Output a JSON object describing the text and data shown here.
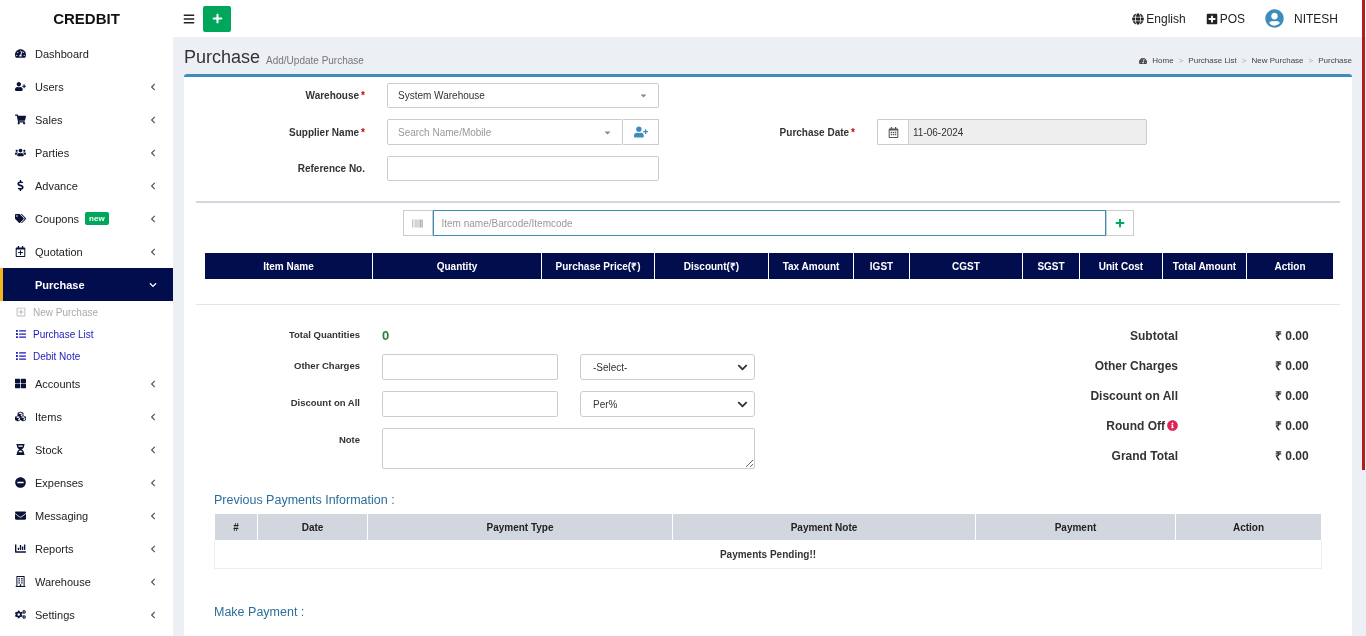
{
  "brand": "CREDBIT",
  "topbar": {
    "language": "English",
    "pos": "POS",
    "user": "NITESH"
  },
  "sidebar": {
    "items": [
      {
        "label": "Dashboard",
        "selected": false
      },
      {
        "label": "Users",
        "selected": false,
        "expanded": false
      },
      {
        "label": "Sales",
        "selected": false,
        "expanded": false
      },
      {
        "label": "Parties",
        "selected": false,
        "expanded": false
      },
      {
        "label": "Advance",
        "selected": false,
        "expanded": false
      },
      {
        "label": "Coupons",
        "badge": "new",
        "selected": false,
        "expanded": false
      },
      {
        "label": "Quotation",
        "selected": false,
        "expanded": false
      },
      {
        "label": "Purchase",
        "selected": true,
        "expanded": true,
        "children": [
          {
            "label": "New Purchase",
            "selected": true
          },
          {
            "label": "Purchase List",
            "selected": false
          },
          {
            "label": "Debit Note",
            "selected": false
          }
        ]
      },
      {
        "label": "Accounts",
        "selected": false,
        "expanded": false
      },
      {
        "label": "Items",
        "selected": false,
        "expanded": false
      },
      {
        "label": "Stock",
        "selected": false,
        "expanded": false
      },
      {
        "label": "Expenses",
        "selected": false,
        "expanded": false
      },
      {
        "label": "Messaging",
        "selected": false,
        "expanded": false
      },
      {
        "label": "Reports",
        "selected": false,
        "expanded": false
      },
      {
        "label": "Warehouse",
        "selected": false,
        "expanded": false
      },
      {
        "label": "Settings",
        "selected": false,
        "expanded": false
      }
    ]
  },
  "page_header": {
    "title": "Purchase",
    "subtitle": "Add/Update Purchase",
    "breadcrumb": [
      "Home",
      "Purchase List",
      "New Purchase",
      "Purchase"
    ],
    "separator": ">"
  },
  "form": {
    "warehouse": {
      "label": "Warehouse",
      "required_mark": "*",
      "value": "System Warehouse"
    },
    "supplier": {
      "label": "Supplier Name",
      "required_mark": "*",
      "placeholder": "Search Name/Mobile"
    },
    "purchase_date": {
      "label": "Purchase Date",
      "required_mark": "*",
      "value": "11-06-2024",
      "disabled": true
    },
    "reference": {
      "label": "Reference No."
    }
  },
  "item_search": {
    "placeholder": "Item name/Barcode/Itemcode"
  },
  "items_table": {
    "columns": [
      "Item Name",
      "Quantity",
      "Purchase Price(₹)",
      "Discount(₹)",
      "Tax Amount",
      "IGST",
      "CGST",
      "SGST",
      "Unit Cost",
      "Total Amount",
      "Action"
    ]
  },
  "summary": {
    "total_quantities": {
      "label": "Total Quantities",
      "value": "0"
    },
    "other_charges": {
      "label": "Other Charges",
      "option": "-Select-"
    },
    "discount_on_all": {
      "label": "Discount on All",
      "option": "Per%"
    },
    "note": {
      "label": "Note"
    }
  },
  "totals": [
    {
      "label": "Subtotal",
      "value": "₹ 0.00",
      "info": false
    },
    {
      "label": "Other Charges",
      "value": "₹ 0.00",
      "info": false
    },
    {
      "label": "Discount on All",
      "value": "₹ 0.00",
      "info": false
    },
    {
      "label": "Round Off",
      "value": "₹ 0.00",
      "info": true
    },
    {
      "label": "Grand Total",
      "value": "₹ 0.00",
      "info": false
    }
  ],
  "previous_payments": {
    "title": "Previous Payments Information :",
    "columns": [
      "#",
      "Date",
      "Payment Type",
      "Payment Note",
      "Payment",
      "Action"
    ],
    "empty_message": "Payments Pending!!"
  },
  "make_payment": {
    "title": "Make Payment :"
  }
}
